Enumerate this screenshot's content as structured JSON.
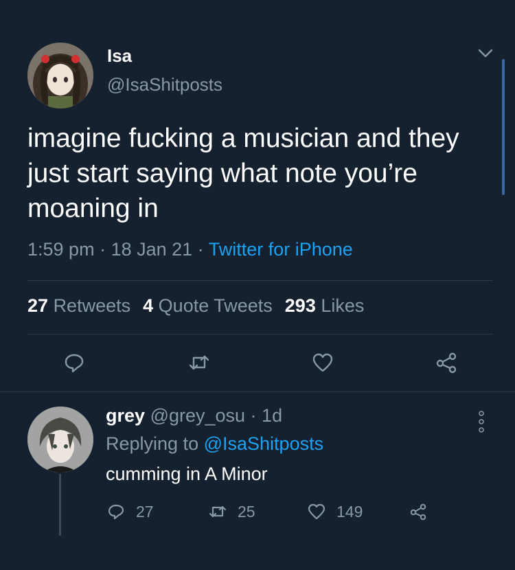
{
  "tweet": {
    "display_name": "Isa",
    "handle": "@IsaShitposts",
    "text": "imagine fucking a musician and they just start saying what note you’re moaning in",
    "time": "1:59 pm",
    "date": "18 Jan 21",
    "separator": " · ",
    "source": "Twitter for iPhone",
    "stats": {
      "retweets": "27",
      "retweets_label": "Retweets",
      "quotes": "4",
      "quotes_label": "Quote Tweets",
      "likes": "293",
      "likes_label": "Likes"
    }
  },
  "reply": {
    "display_name": "grey",
    "handle": "@grey_osu",
    "age": "1d",
    "separator": " · ",
    "replying_prefix": "Replying to",
    "replying_handle": "@IsaShitposts",
    "text": "cumming in A Minor",
    "replies": "27",
    "retweets": "25",
    "likes": "149"
  },
  "icons": {
    "chevron": "chevron-down-icon",
    "reply": "reply-icon",
    "retweet": "retweet-icon",
    "like": "heart-icon",
    "share": "share-icon",
    "more": "more-options-icon"
  },
  "colors": {
    "background": "#162130",
    "text": "#ffffff",
    "muted": "#8899a6",
    "link": "#1da1f2",
    "divider": "#2b3a4c"
  }
}
